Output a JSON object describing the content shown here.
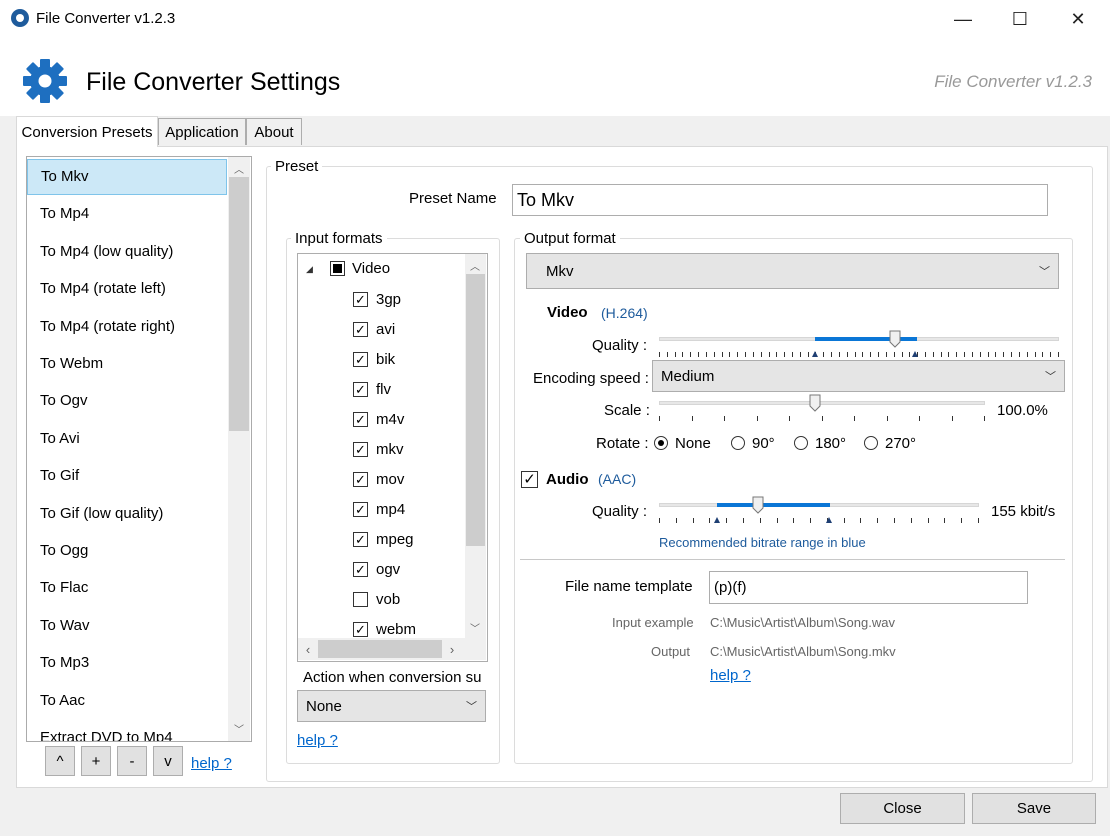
{
  "window": {
    "title": "File Converter v1.2.3",
    "minimize": "—",
    "maximize": "☐",
    "close": "✕"
  },
  "header": {
    "title": "File Converter Settings",
    "version": "File Converter v1.2.3"
  },
  "tabs": [
    "Conversion Presets",
    "Application",
    "About"
  ],
  "presets": [
    "To Mkv",
    "To Mp4",
    "To Mp4 (low quality)",
    "To Mp4 (rotate left)",
    "To Mp4 (rotate right)",
    "To Webm",
    "To Ogv",
    "To Avi",
    "To Gif",
    "To Gif (low quality)",
    "To Ogg",
    "To Flac",
    "To Wav",
    "To Mp3",
    "To Aac",
    "Extract DVD to Mp4"
  ],
  "preset_buttons": {
    "up": "^",
    "add": "+",
    "remove": "-",
    "down": "v",
    "help": "help ?"
  },
  "preset": {
    "group_title": "Preset",
    "name_label": "Preset Name",
    "name_value": "To Mkv"
  },
  "input_formats": {
    "title": "Input formats",
    "root": "Video",
    "items": [
      {
        "label": "3gp",
        "checked": true
      },
      {
        "label": "avi",
        "checked": true
      },
      {
        "label": "bik",
        "checked": true
      },
      {
        "label": "flv",
        "checked": true
      },
      {
        "label": "m4v",
        "checked": true
      },
      {
        "label": "mkv",
        "checked": true
      },
      {
        "label": "mov",
        "checked": true
      },
      {
        "label": "mp4",
        "checked": true
      },
      {
        "label": "mpeg",
        "checked": true
      },
      {
        "label": "ogv",
        "checked": true
      },
      {
        "label": "vob",
        "checked": false
      },
      {
        "label": "webm",
        "checked": true
      }
    ],
    "action_label": "Action when conversion su",
    "action_value": "None",
    "help": "help ?"
  },
  "output_format": {
    "title": "Output format",
    "format_value": "Mkv",
    "video_label": "Video",
    "video_codec": "(H.264)",
    "quality_label": "Quality :",
    "video_quality": 0.59,
    "encoding_label": "Encoding speed :",
    "encoding_value": "Medium",
    "scale_label": "Scale :",
    "scale_value": "100.0%",
    "rotate_label": "Rotate :",
    "rotate_options": [
      "None",
      "90°",
      "180°",
      "270°"
    ],
    "rotate_selected": "None",
    "audio_label": "Audio",
    "audio_codec": "(AAC)",
    "audio_quality_label": "Quality :",
    "audio_quality_value": "155 kbit/s",
    "audio_note": "Recommended bitrate range in blue",
    "template_label": "File name template",
    "template_value": "(p)(f)",
    "input_example_label": "Input example",
    "input_example_value": "C:\\Music\\Artist\\Album\\Song.wav",
    "output_label": "Output",
    "output_value": "C:\\Music\\Artist\\Album\\Song.mkv",
    "help": "help ?"
  },
  "footer": {
    "close": "Close",
    "save": "Save"
  },
  "colors": {
    "accent": "#0a76d6",
    "selection": "#cce8f7",
    "link": "#0066cc"
  }
}
